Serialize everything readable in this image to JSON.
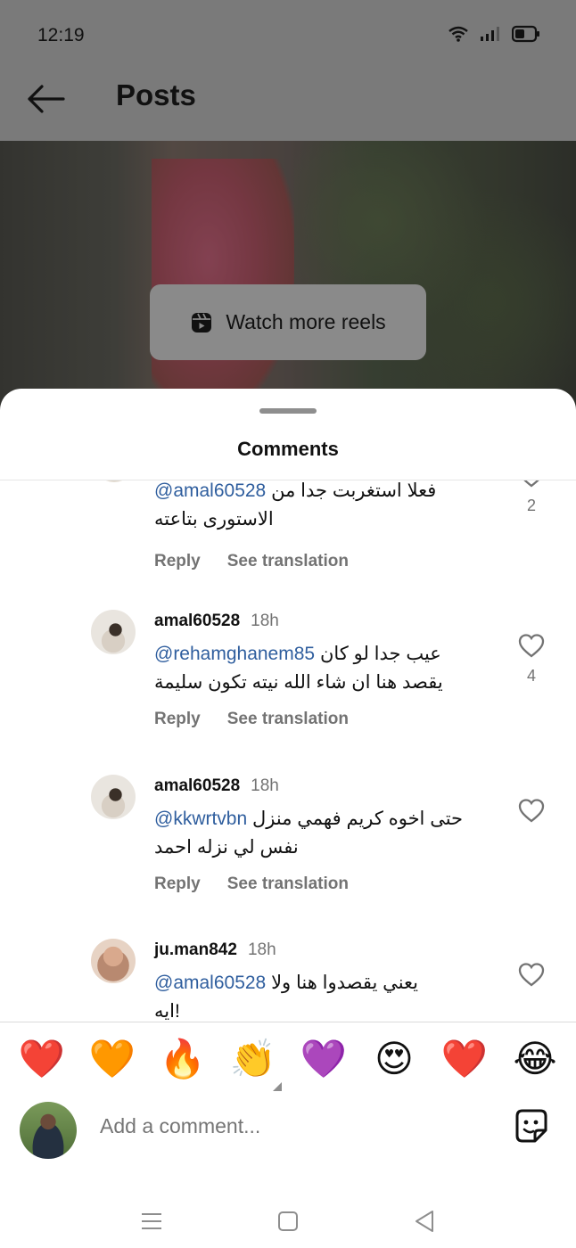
{
  "status_bar": {
    "time": "12:19"
  },
  "header": {
    "title": "Posts"
  },
  "reel_overlay": {
    "watch_more_label": "Watch more reels"
  },
  "sheet": {
    "title": "Comments"
  },
  "comments": [
    {
      "username": "",
      "time": "",
      "mention": "@amal60528",
      "text_line1": "فعلا استغربت جدا من",
      "text_line2": "الاستورى بتاعته",
      "reply_label": "Reply",
      "translate_label": "See translation",
      "likes": "2"
    },
    {
      "username": "amal60528",
      "time": "18h",
      "mention": "@rehamghanem85",
      "text_line1": "عيب جدا لو كان",
      "text_line2": "يقصد هنا ان شاء الله نيته تكون سليمة",
      "reply_label": "Reply",
      "translate_label": "See translation",
      "likes": "4"
    },
    {
      "username": "amal60528",
      "time": "18h",
      "mention": "@kkwrtvbn",
      "text_line1": "حتى اخوه كريم فهمي منزل",
      "text_line2": "نفس لي نزله احمد",
      "reply_label": "Reply",
      "translate_label": "See translation",
      "likes": ""
    },
    {
      "username": "ju.man842",
      "time": "18h",
      "mention": "@amal60528",
      "text_line1": "يعني يقصدوا هنا ولا",
      "text_line2": "ايه!",
      "reply_label": "",
      "translate_label": "",
      "likes": ""
    }
  ],
  "emoji_reactions": [
    "❤️",
    "🧡",
    "🔥",
    "👏",
    "💜",
    "😍",
    "❤️",
    "😂"
  ],
  "composer": {
    "placeholder": "Add a comment..."
  },
  "icons": {
    "back": "back-arrow-icon",
    "wifi": "wifi-icon",
    "signal": "signal-icon",
    "battery": "battery-icon",
    "reels": "reels-icon",
    "like": "heart-outline-icon",
    "sticker": "sticker-icon",
    "nav_menu": "menu-icon",
    "nav_home": "home-square-icon",
    "nav_back": "back-triangle-icon"
  },
  "colors": {
    "mention": "#2f5e9e",
    "muted": "#737373",
    "overlay": "#7a7a7a"
  }
}
